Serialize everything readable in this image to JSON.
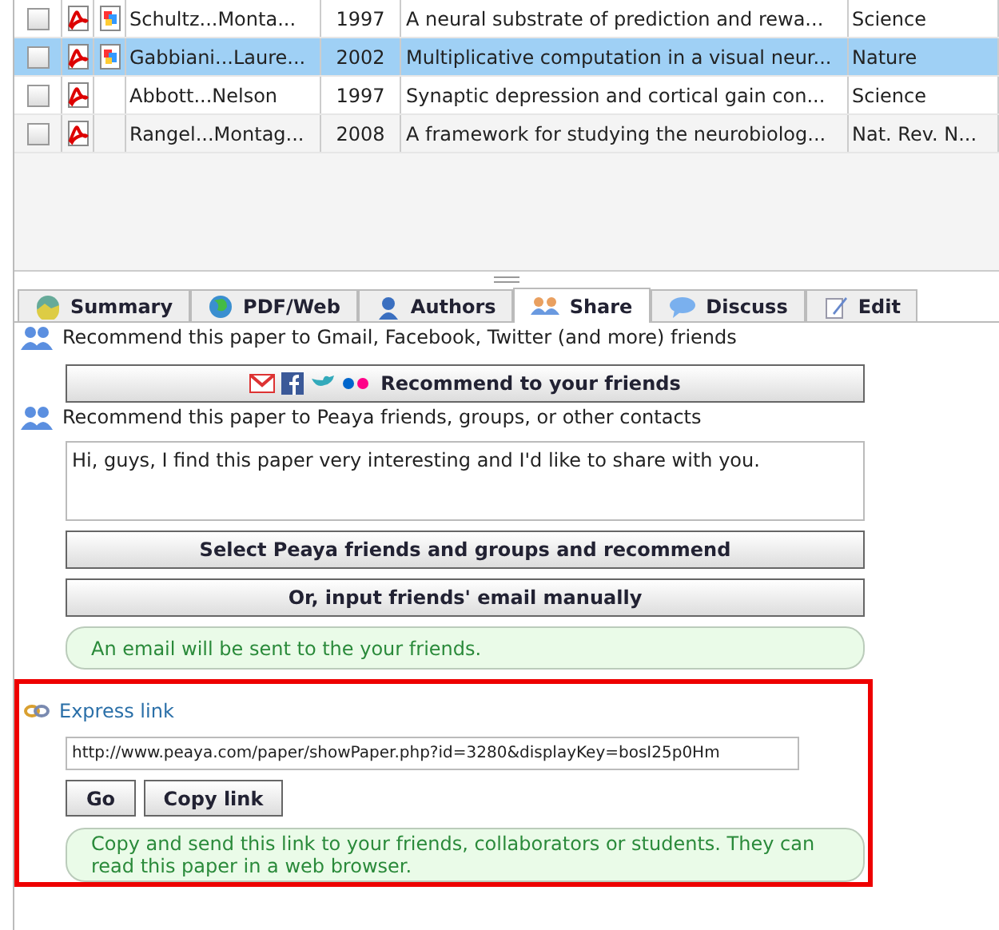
{
  "papers": [
    {
      "checked": false,
      "selected": false,
      "pdf": true,
      "web": true,
      "authors": "Schultz...Monta...",
      "year": "1997",
      "title": "A neural substrate of prediction and rewa...",
      "journal": "Science"
    },
    {
      "checked": false,
      "selected": true,
      "pdf": true,
      "web": true,
      "authors": "Gabbiani...Laure...",
      "year": "2002",
      "title": "Multiplicative computation in a visual neur...",
      "journal": "Nature"
    },
    {
      "checked": false,
      "selected": false,
      "pdf": true,
      "web": false,
      "authors": "Abbott...Nelson",
      "year": "1997",
      "title": "Synaptic depression and cortical gain con...",
      "journal": "Science"
    },
    {
      "checked": false,
      "selected": false,
      "pdf": true,
      "web": false,
      "authors": "Rangel...Montag...",
      "year": "2008",
      "title": "A framework for studying the neurobiolog...",
      "journal": "Nat. Rev. N..."
    }
  ],
  "tabs": [
    {
      "kind": "summary",
      "label": "Summary",
      "selected": false
    },
    {
      "kind": "web",
      "label": "PDF/Web",
      "selected": false
    },
    {
      "kind": "authors",
      "label": "Authors",
      "selected": false
    },
    {
      "kind": "share",
      "label": "Share",
      "selected": true
    },
    {
      "kind": "discuss",
      "label": "Discuss",
      "selected": false
    },
    {
      "kind": "edit",
      "label": "Edit",
      "selected": false
    }
  ],
  "share": {
    "social_heading": "Recommend this paper to Gmail, Facebook, Twitter (and more) friends",
    "social_button": "Recommend to your friends",
    "peaya_heading": "Recommend this paper to Peaya friends, groups, or other contacts",
    "message": "Hi, guys, I find this paper very interesting and I'd like to share with you.",
    "select_button": "Select Peaya friends and groups and recommend",
    "manual_button": "Or, input friends' email manually",
    "email_note": "An email will be sent to the your friends."
  },
  "express_link": {
    "heading": "Express link",
    "url": "http://www.peaya.com/paper/showPaper.php?id=3280&displayKey=bosI25p0Hm",
    "go_button": "Go",
    "copy_button": "Copy link",
    "note": "Copy and send this link to your friends, collaborators or students. They can read this paper in a web browser."
  }
}
